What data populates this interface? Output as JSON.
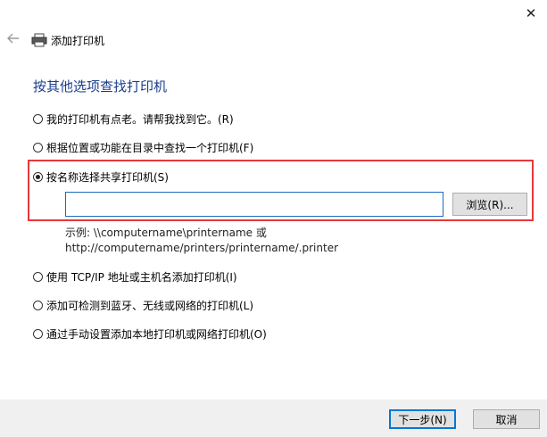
{
  "window": {
    "close_glyph": "✕",
    "title": "添加打印机"
  },
  "heading": "按其他选项查找打印机",
  "options": [
    {
      "label": "我的打印机有点老。请帮我找到它。(R)",
      "checked": false
    },
    {
      "label": "根据位置或功能在目录中查找一个打印机(F)",
      "checked": false
    },
    {
      "label": "按名称选择共享打印机(S)",
      "checked": true
    },
    {
      "label": "使用 TCP/IP 地址或主机名添加打印机(I)",
      "checked": false
    },
    {
      "label": "添加可检测到蓝牙、无线或网络的打印机(L)",
      "checked": false
    },
    {
      "label": "通过手动设置添加本地打印机或网络打印机(O)",
      "checked": false
    }
  ],
  "shared_printer": {
    "input_value": "",
    "browse_label": "浏览(R)...",
    "example_line1": "示例: \\\\computername\\printername 或",
    "example_line2": "http://computername/printers/printername/.printer"
  },
  "footer": {
    "next_label": "下一步(N)",
    "cancel_label": "取消"
  },
  "colors": {
    "heading": "#1a3e8c",
    "highlight": "#e5383b",
    "input_border": "#1a6bbd",
    "primary_button_border": "#0078d7"
  },
  "icons": {
    "back": "arrow-left-icon",
    "printer": "printer-icon",
    "close": "close-icon"
  }
}
